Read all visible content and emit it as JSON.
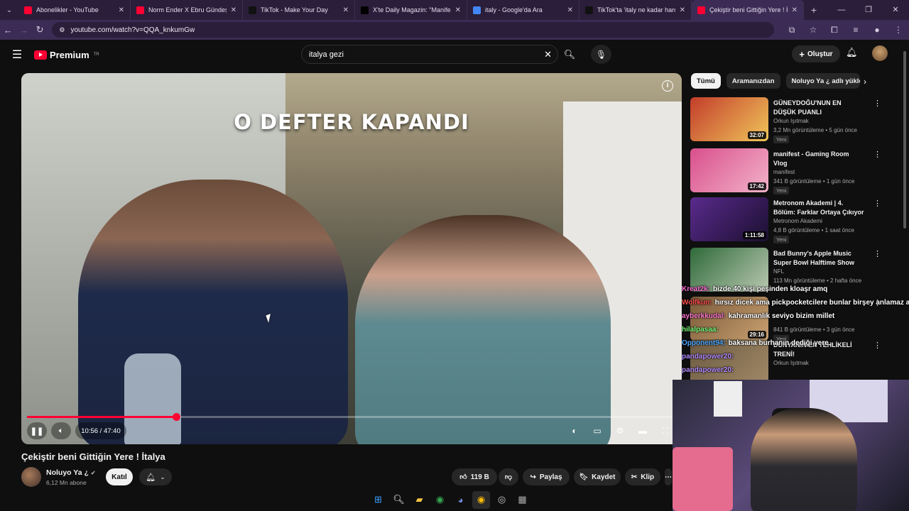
{
  "browser": {
    "tabs": [
      {
        "title": "Abonelikler - YouTube",
        "color": "#ff0033"
      },
      {
        "title": "Norm Ender X Ebru Gündeş - B",
        "color": "#ff0033"
      },
      {
        "title": "TikTok - Make Your Day",
        "color": "#111111"
      },
      {
        "title": "X'te Daily Magazin: \"Manifest u",
        "color": "#000000"
      },
      {
        "title": "italy - Google'da Ara",
        "color": "#4285f4"
      },
      {
        "title": "TikTok'ta 'italy ne kadar harcad",
        "color": "#111111"
      },
      {
        "title": "Çekiştir beni Gittiğin Yere ! İ",
        "color": "#ff0033"
      }
    ],
    "url": "youtube.com/watch?v=QQA_knkumGw"
  },
  "header": {
    "brand": "Premium",
    "brand_sup": "TR",
    "search_value": "italya gezi",
    "create_label": "Oluştur"
  },
  "player": {
    "caption": "O DEFTER KAPANDI",
    "time": "10:56 / 47:40",
    "progress": 0.2294
  },
  "video": {
    "title": "Çekiştir beni Gittiğin Yere ! İtalya",
    "channel": "Noluyo Ya ¿",
    "subscribers": "6,12 Mn abone",
    "join_label": "Katıl",
    "likes": "119 B",
    "share_label": "Paylaş",
    "save_label": "Kaydet",
    "clip_label": "Klip"
  },
  "sidebar": {
    "chips": [
      "Tümü",
      "Aramanızdan",
      "Noluyo Ya ¿ adlı yükleyic"
    ],
    "recs": [
      {
        "title": "GÜNEYDOĞU'NUN EN DÜŞÜK PUANLI RESTORANTLARI!",
        "channel": "Orkun Işıtmak",
        "meta": "3,2 Mn görüntüleme • 5 gün önce",
        "badge": "Yeni",
        "duration": "32:07",
        "c1": "#c33d2b",
        "c2": "#f0c55a"
      },
      {
        "title": "manifest - Gaming Room Vlog",
        "channel": "manifest",
        "meta": "341 B görüntüleme • 1 gün önce",
        "badge": "Yeni",
        "duration": "17:42",
        "c1": "#d94f8c",
        "c2": "#f3b3c9"
      },
      {
        "title": "Metronom Akademi | 4. Bölüm: Farklar Ortaya Çıkıyor",
        "channel": "Metronom Akademi",
        "meta": "4,8 B görüntüleme • 1 saat önce",
        "badge": "Yeni",
        "duration": "1:11:58",
        "c1": "#5a2a8c",
        "c2": "#1b1030"
      },
      {
        "title": "Bad Bunny's Apple Music Super Bowl Halftime Show",
        "channel": "NFL",
        "meta": "113 Mn görüntüleme • 2 hafta önce",
        "badge": "",
        "duration": "",
        "c1": "#2f6a3a",
        "c2": "#b9c8b0"
      },
      {
        "title": "",
        "channel": "",
        "meta": "841 B görüntüleme • 3 gün önce",
        "badge": "Yeni",
        "duration": "29:16",
        "c1": "#7a5a3a",
        "c2": "#c9a070"
      },
      {
        "title": "DÜNYANIN EN TEHLİKELİ TRENİ!",
        "channel": "Orkun Işıtmak",
        "meta": "",
        "badge": "",
        "duration": "",
        "c1": "#6b5a42",
        "c2": "#a08865"
      }
    ]
  },
  "chat": [
    {
      "user": "Kreat2k:",
      "color": "#ff6bd5",
      "msg": "bizde 40 kişi peşinden kloaşr amq"
    },
    {
      "user": "Wolfkun:",
      "color": "#ff4d4d",
      "msg": "hırsız dicek ama pickpocketcilere bunlar birşey anlamaz aq"
    },
    {
      "user": "ayberkkudal:",
      "color": "#ff7ad0",
      "msg": "kahramanlık seviyo bizim millet"
    },
    {
      "user": "hilalpasaa:",
      "color": "#7cff7c",
      "msg": ""
    },
    {
      "user": "Opponent94:",
      "color": "#4da6ff",
      "msg": "baksana burhanın dediği yere"
    },
    {
      "user": "pandapower20:",
      "color": "#b38cff",
      "msg": ""
    },
    {
      "user": "pandapower20:",
      "color": "#b38cff",
      "msg": ""
    }
  ]
}
